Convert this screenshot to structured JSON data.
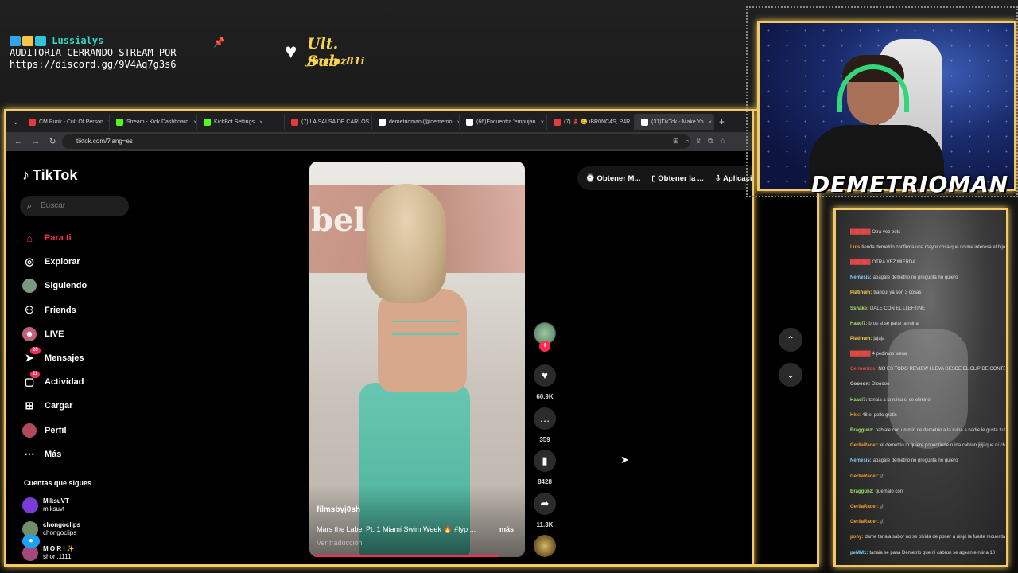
{
  "overlay": {
    "username": "Lussialys",
    "line1": "AUDITORIA CERRANDO STREAM POR",
    "line2": "https://discord.gg/9V4Aq7g3s6",
    "sub_title": "Ult. Sub",
    "sub_name": "Jhoanz81i",
    "badge_colors": [
      "#2ea8e6",
      "#f6c547",
      "#31c3d6"
    ]
  },
  "browser": {
    "tabs": [
      {
        "label": "CM Punk - Cult Of Person",
        "fav": "#e83a3a"
      },
      {
        "label": "Stream - Kick Dashboard",
        "fav": "#53fc18"
      },
      {
        "label": "KickBot Settings",
        "fav": "#53fc18"
      },
      {
        "label": "(7) LA SALSA DE CARLOS",
        "fav": "#e83a3a"
      },
      {
        "label": "demetrioman (@demetrio",
        "fav": "#ffffff"
      },
      {
        "label": "(66)Encuentra 'empujan",
        "fav": "#ffffff"
      },
      {
        "label": "(7) 💄 😄 iBR0NC4S, P4R",
        "fav": "#e83a3a"
      },
      {
        "label": "(31)TikTok - Make Yo",
        "fav": "#ffffff"
      }
    ],
    "url": "tiktok.com/?lang=es"
  },
  "tiktok": {
    "logo": "TikTok",
    "search_placeholder": "Buscar",
    "menu": [
      {
        "label": "Para ti",
        "icon": "home-icon",
        "active": true
      },
      {
        "label": "Explorar",
        "icon": "compass-icon"
      },
      {
        "label": "Siguiendo",
        "icon": "following-avatar-icon"
      },
      {
        "label": "Friends",
        "icon": "friends-icon"
      },
      {
        "label": "LIVE",
        "icon": "live-icon"
      },
      {
        "label": "Mensajes",
        "icon": "messages-icon",
        "badge": "20"
      },
      {
        "label": "Actividad",
        "icon": "activity-icon",
        "badge": "11"
      },
      {
        "label": "Cargar",
        "icon": "upload-icon"
      },
      {
        "label": "Perfil",
        "icon": "profile-icon"
      },
      {
        "label": "Más",
        "icon": "more-icon"
      }
    ],
    "following_title": "Cuentas que sigues",
    "following": [
      {
        "name": "MiksuVT",
        "handle": "miksuvt"
      },
      {
        "name": "chongoclips",
        "handle": "chongoclips"
      },
      {
        "name": "M O R I ✨",
        "handle": "shori.1111"
      }
    ],
    "video": {
      "sign_text": "bel",
      "author": "filmsbyj0sh",
      "caption": "Mars the Label Pt. 1 Miami Swim Week 🔥 #fyp ...",
      "more": "más",
      "translate": "Ver traducción",
      "progress": 0.88
    },
    "actions": {
      "likes": "60.9K",
      "comments": "359",
      "saves": "8428",
      "shares": "11.3K"
    },
    "top_pills": [
      "Obtener M...",
      "Obtener la ...",
      "Aplicación"
    ]
  },
  "cam": {
    "name": "DEMETRIOMAN"
  },
  "chat": {
    "lines": [
      {
        "user": "██████",
        "text": "Otra vez bots",
        "color": "#e04747"
      },
      {
        "user": "Luis",
        "text": "tienda demetrio confirma una mayor cosa que no me interesa el hijo de otro",
        "color": "#f0a030"
      },
      {
        "user": "██████",
        "text": "OTRA VEZ MIERDA",
        "color": "#e04747"
      },
      {
        "user": "Nemesis:",
        "text": "apagale demetrio no pregunta no quiero",
        "color": "#7fd0ff"
      },
      {
        "user": "Platinum:",
        "text": "tranqui ya son 3 cosas",
        "color": "#f6d44b"
      },
      {
        "user": "Ssnake:",
        "text": "DALE CON EL LLEFTINE",
        "color": "#9fe06a"
      },
      {
        "user": "Haaci7:",
        "text": "bros si se parte la ruina",
        "color": "#9fe06a"
      },
      {
        "user": "Platinum:",
        "text": "jajaja",
        "color": "#f6d44b"
      },
      {
        "user": "██████",
        "text": "4 pedimos wena",
        "color": "#e04747"
      },
      {
        "user": "Cermentos:",
        "text": "NO ES TODO REVIEW LLEVA DESDE EL CLIP DE CONTEXTO!!!",
        "color": "#e04747"
      },
      {
        "user": "Ooooon:",
        "text": "Diooooo",
        "color": "#cccccc"
      },
      {
        "user": "Haaci7:",
        "text": "tanaia a la ruina si se elimino",
        "color": "#9fe06a"
      },
      {
        "user": "Hkk:",
        "text": "48 el pollo gratis",
        "color": "#f0a030"
      },
      {
        "user": "Braggunz:",
        "text": "hablale con un mio de demetrio a la ruina a nadie le gusta tu forma de ser",
        "color": "#9fe06a"
      },
      {
        "user": "GerliaRader:",
        "text": "el demetrio lo quiere poner tiene ruina cabron jijiji que ni ch?",
        "color": "#f0a030"
      },
      {
        "user": "Nemesis:",
        "text": "apagale demetrio no pregunta no quiero",
        "color": "#7fd0ff"
      },
      {
        "user": "GerliaRader:",
        "text": "¡!",
        "color": "#f0a030"
      },
      {
        "user": "Braggunz:",
        "text": "quemalo con",
        "color": "#9fe06a"
      },
      {
        "user": "GerliaRader:",
        "text": "¡!",
        "color": "#f0a030"
      },
      {
        "user": "GerliaRader:",
        "text": "¡!",
        "color": "#f0a030"
      },
      {
        "user": "pony:",
        "text": "dame tanaia sabor no se olvida de poner a ninja la fuerte recuerda",
        "color": "#f0a030"
      },
      {
        "user": "peMM1:",
        "text": "tanaia se pasa Demetrio que ni cabron se ageante ruina 10",
        "color": "#7fd0ff"
      }
    ]
  }
}
